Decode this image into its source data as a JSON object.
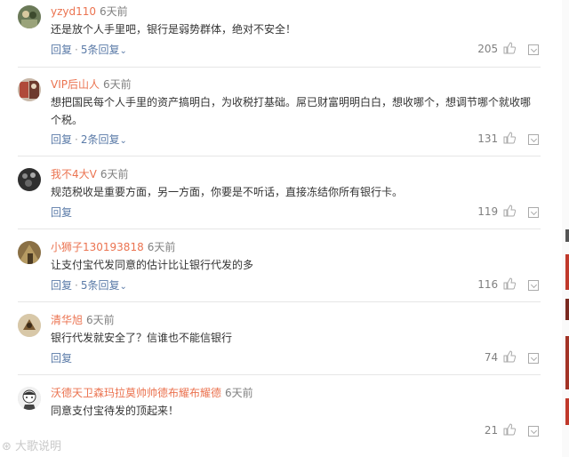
{
  "comments": [
    {
      "username": "yzyd110",
      "time": "6天前",
      "text": "还是放个人手里吧，银行是弱势群体，绝对不安全！",
      "reply_label": "回复",
      "replies_label": "5条回复",
      "likes": "205",
      "avatar_color": "#6b7a58"
    },
    {
      "username": "VIP后山人",
      "time": "6天前",
      "text": "想把国民每个人手里的资产搞明白，为收税打基础。屌已财富明明白白，想收哪个，想调节哪个就收哪个税。",
      "reply_label": "回复",
      "replies_label": "2条回复",
      "likes": "131",
      "avatar_color": "#b04a3a"
    },
    {
      "username": "我不4大V",
      "time": "6天前",
      "text": "规范税收是重要方面，另一方面，你要是不听话，直接冻结你所有银行卡。",
      "reply_label": "回复",
      "replies_label": "",
      "likes": "119",
      "avatar_color": "#2f2f2f"
    },
    {
      "username": "小狮子130193818",
      "time": "6天前",
      "text": "让支付宝代发同意的估计比让银行代发的多",
      "reply_label": "回复",
      "replies_label": "5条回复",
      "likes": "116",
      "avatar_color": "#8a7045"
    },
    {
      "username": "清华旭",
      "time": "6天前",
      "text": "银行代发就安全了？信谁也不能信银行",
      "reply_label": "回复",
      "replies_label": "",
      "likes": "74",
      "avatar_color": "#d8c8a8"
    },
    {
      "username": "沃德天卫森玛拉莫帅帅德布耀布耀德",
      "time": "6天前",
      "text": "同意支付宝待发的顶起来！",
      "reply_label": "回复",
      "replies_label": "",
      "likes": "21",
      "avatar_color": "#f0f0f0"
    }
  ],
  "watermark": "大歌说明",
  "colors": {
    "username": "#eb7350",
    "action": "#5b7ba8",
    "muted": "#808080"
  },
  "icons": {
    "like": "thumbs-up-icon",
    "report": "flag-icon"
  }
}
